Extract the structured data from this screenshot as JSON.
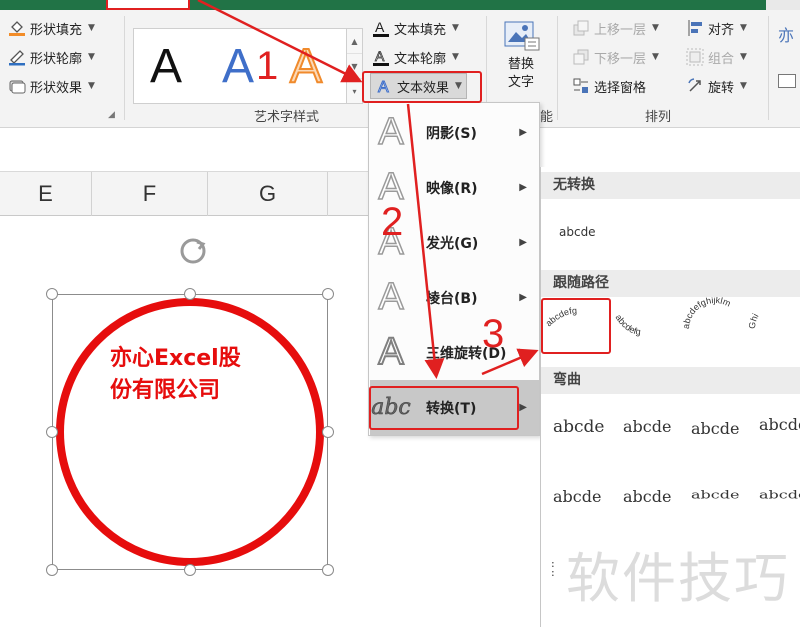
{
  "ribbon": {
    "shape_styles": {
      "fill": "形状填充",
      "outline": "形状轮廓",
      "effects": "形状效果"
    },
    "wordart": {
      "samples": [
        "A",
        "A",
        "A"
      ],
      "text_fill": "文本填充",
      "text_outline": "文本轮廓",
      "text_effects": "文本效果",
      "group_label": "艺术字样式"
    },
    "alt_text": {
      "line1": "替换",
      "line2": "文字",
      "group_label_partial": "能"
    },
    "arrange": {
      "bring_forward": "上移一层",
      "send_backward": "下移一层",
      "selection_pane": "选择窗格",
      "align": "对齐",
      "group": "组合",
      "rotate": "旋转",
      "group_label": "排列"
    },
    "right_edge": "亦"
  },
  "columns": [
    "E",
    "F",
    "G"
  ],
  "shape": {
    "text": "亦心Excel股份有限公司",
    "color": "#e60d0d"
  },
  "text_effects_menu": {
    "items": [
      {
        "label": "阴影(S)"
      },
      {
        "label": "映像(R)"
      },
      {
        "label": "发光(G)"
      },
      {
        "label": "棱台(B)"
      },
      {
        "label": "三维旋转(D)"
      },
      {
        "label": "转换(T)",
        "icon_text": "abc"
      }
    ]
  },
  "transform_submenu": {
    "sections": {
      "no_transform": "无转换",
      "follow_path": "跟随路径",
      "warp": "弯曲"
    },
    "no_transform_sample": "abcde",
    "path_samples": [
      "abcdefg",
      "abcdefg",
      "abcdefghijklm",
      "Ghi"
    ],
    "warp_samples": [
      "abcde",
      "abcde",
      "abcde",
      "abcde",
      "abcde",
      "abcde",
      "abcde",
      "abcde"
    ]
  },
  "annotations": {
    "steps": [
      "1",
      "2",
      "3"
    ],
    "color": "#e02020"
  },
  "watermark": "软件技巧"
}
